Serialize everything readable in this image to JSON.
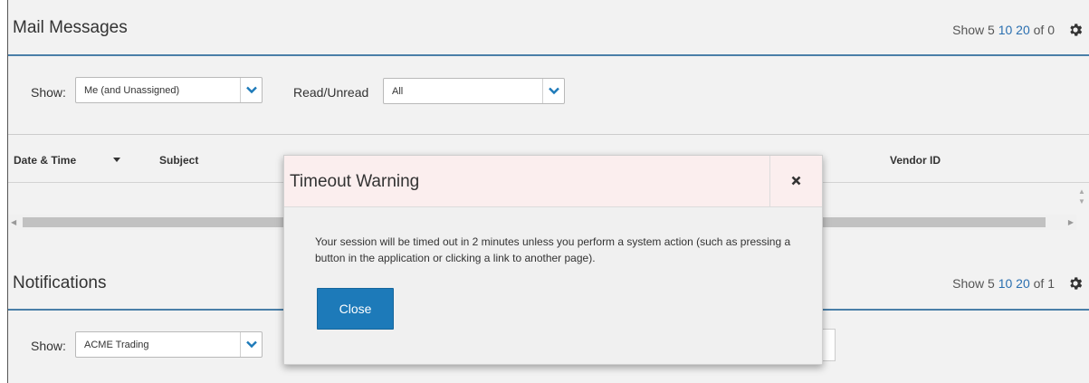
{
  "mail": {
    "title": "Mail Messages",
    "paging": {
      "prefix": "Show 5",
      "opt10": "10",
      "opt20": "20",
      "suffix": "of 0"
    },
    "filters": {
      "show_label": "Show:",
      "show_value": "Me (and Unassigned)",
      "read_label": "Read/Unread",
      "read_value": "All"
    },
    "columns": [
      "Date & Time",
      "Subject",
      "Vendor ID"
    ]
  },
  "notifications": {
    "title": "Notifications",
    "paging": {
      "prefix": "Show 5",
      "opt10": "10",
      "opt20": "20",
      "suffix": "of 1"
    },
    "filters": {
      "show_label": "Show:",
      "show_value": "ACME Trading"
    }
  },
  "modal": {
    "title": "Timeout Warning",
    "message": "Your session will be timed out in 2 minutes unless you perform a system action (such as pressing a button in the application or clicking a link to another page).",
    "close_label": "Close"
  },
  "icons": {
    "settings": "gear-icon",
    "dropdown": "chevron-down-icon",
    "dismiss": "close-icon",
    "sort": "sort-desc-icon"
  },
  "colors": {
    "accent": "#1d7ab9",
    "rule": "#4a7fa8",
    "link": "#2a6fb0",
    "modal_header": "#fbeeee"
  }
}
